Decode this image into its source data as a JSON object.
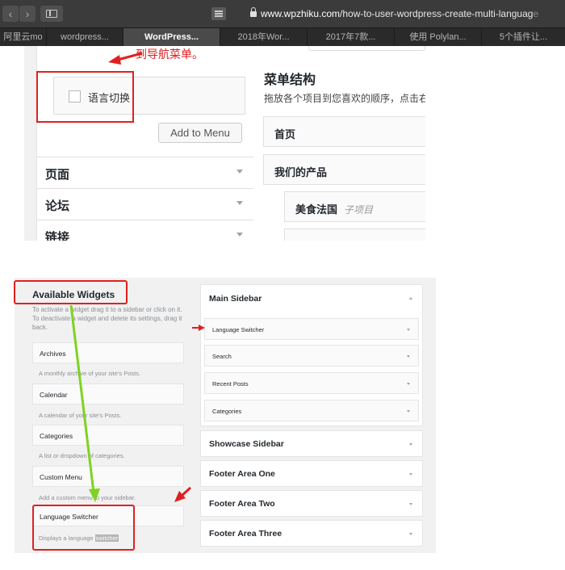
{
  "browser": {
    "url_domain": "www.wpzhiku.com",
    "url_path": "/how-to-user-wordpress-create-multi-languag",
    "url_fade": "e",
    "tabs": [
      "阿里云mo",
      "wordpress...",
      "WordPress...",
      "2018年Wor...",
      "2017年7款...",
      "使用 Polylan...",
      "5个插件让..."
    ],
    "active_tab_index": 2
  },
  "menu_editor": {
    "annotation": "到导航菜单。",
    "checkbox_label": "语言切换",
    "add_button": "Add to Menu",
    "sections": [
      "页面",
      "论坛",
      "链接"
    ],
    "structure_title": "菜单结构",
    "structure_desc": "拖放各个项目到您喜欢的顺序，点击右",
    "items": [
      {
        "label": "首页",
        "sub": ""
      },
      {
        "label": "我们的产品",
        "sub": ""
      },
      {
        "label": "美食法国",
        "sub": "子项目"
      }
    ]
  },
  "widgets": {
    "title": "Available Widgets",
    "description": "To activate a widget drag it to a sidebar or click on it. To deactivate a widget and delete its settings, drag it back.",
    "available": [
      {
        "name": "Archives",
        "desc": "A monthly archive of your site's Posts."
      },
      {
        "name": "Calendar",
        "desc": "A calendar of your site's Posts."
      },
      {
        "name": "Categories",
        "desc": "A list or dropdown of categories."
      },
      {
        "name": "Custom Menu",
        "desc": "Add a custom menu to your sidebar."
      },
      {
        "name": "Language Switcher",
        "desc_prefix": "Displays a language ",
        "desc_highlight": "switcher"
      }
    ],
    "main_sidebar": {
      "title": "Main Sidebar",
      "widgets": [
        "Language Switcher",
        "Search",
        "Recent Posts",
        "Categories"
      ]
    },
    "other_sidebars": [
      "Showcase Sidebar",
      "Footer Area One",
      "Footer Area Two",
      "Footer Area Three"
    ]
  },
  "colors": {
    "annotation_red": "#e02020",
    "annotation_green": "#7ed321",
    "chrome_dark": "#3b3b3b"
  }
}
